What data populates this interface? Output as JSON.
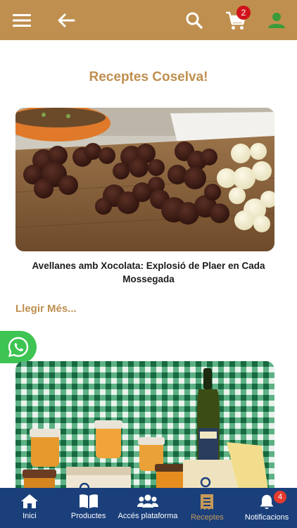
{
  "header": {
    "cart_count": "2",
    "colors": {
      "bar": "#bf8f4f",
      "user_icon": "#3a9a3a",
      "badge": "#d0131b"
    }
  },
  "main": {
    "page_title": "Receptes Coselva!",
    "recipes": [
      {
        "title": "Avellanes amb Xocolata: Explosió de Plaer en Cada Mossegada",
        "read_more": "Llegir Més..."
      }
    ]
  },
  "bottom_nav": {
    "items": [
      {
        "label": "Inici",
        "icon": "home-icon"
      },
      {
        "label": "Productes",
        "icon": "book-icon"
      },
      {
        "label": "Accés plataforma",
        "icon": "users-icon"
      },
      {
        "label": "Receptes",
        "icon": "receipt-icon",
        "active": true
      },
      {
        "label": "Notificacions",
        "icon": "bell-icon",
        "badge": "4"
      }
    ],
    "colors": {
      "bar": "#1a3f7b",
      "active": "#c79a58",
      "badge": "#e23b2e"
    }
  }
}
